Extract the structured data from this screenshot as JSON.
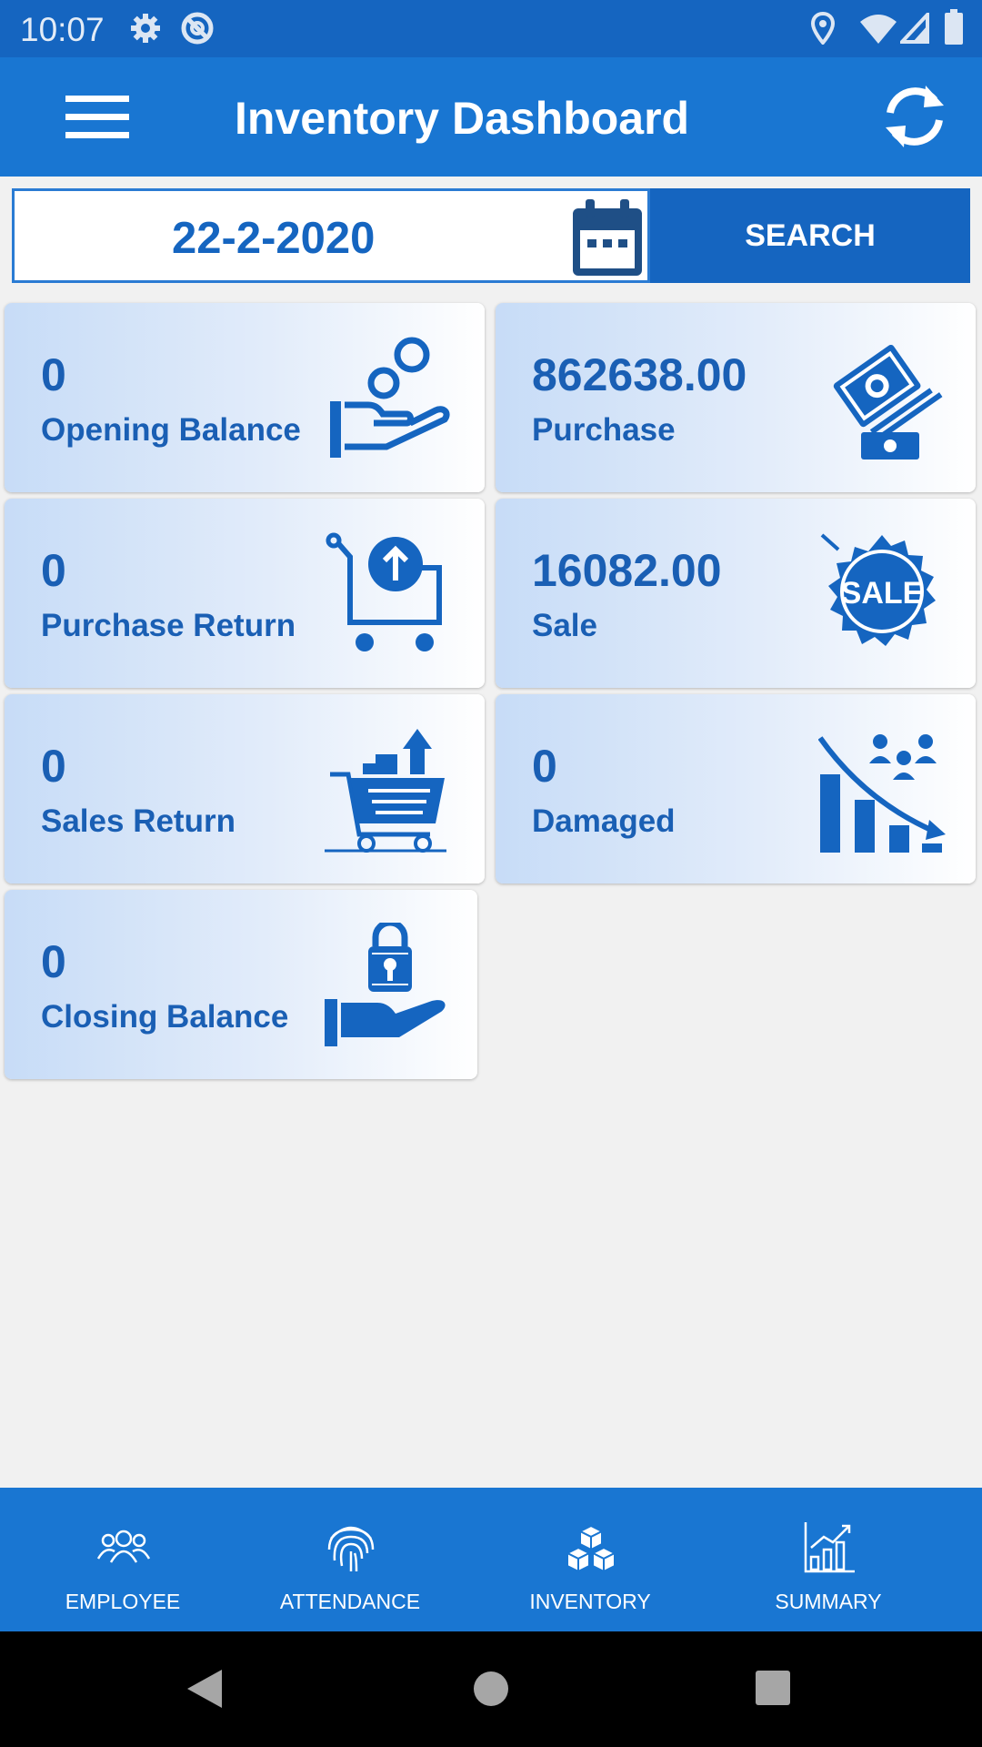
{
  "status_bar": {
    "time": "10:07"
  },
  "app_bar": {
    "title": "Inventory Dashboard"
  },
  "date_filter": {
    "date": "22-2-2020",
    "search_label": "SEARCH"
  },
  "cards": [
    {
      "value": "0",
      "label": "Opening Balance",
      "icon": "hand-coin-icon"
    },
    {
      "value": "862638.00",
      "label": "Purchase",
      "icon": "money-hand-icon"
    },
    {
      "value": "0",
      "label": "Purchase Return",
      "icon": "cart-upload-icon"
    },
    {
      "value": "16082.00",
      "label": "Sale",
      "icon": "sale-badge-icon"
    },
    {
      "value": "0",
      "label": "Sales Return",
      "icon": "cart-boxes-icon"
    },
    {
      "value": "0",
      "label": "Damaged",
      "icon": "declining-chart-icon"
    },
    {
      "value": "0",
      "label": "Closing Balance",
      "icon": "hand-lock-icon"
    }
  ],
  "bottom_nav": [
    {
      "label": "EMPLOYEE",
      "icon": "people-icon"
    },
    {
      "label": "ATTENDANCE",
      "icon": "fingerprint-icon"
    },
    {
      "label": "INVENTORY",
      "icon": "cubes-icon"
    },
    {
      "label": "SUMMARY",
      "icon": "bar-chart-icon"
    }
  ],
  "colors": {
    "primary": "#1976d2",
    "primary_dark": "#1565c0",
    "text_blue": "#1a5fb4",
    "background": "#f1f1f1"
  }
}
